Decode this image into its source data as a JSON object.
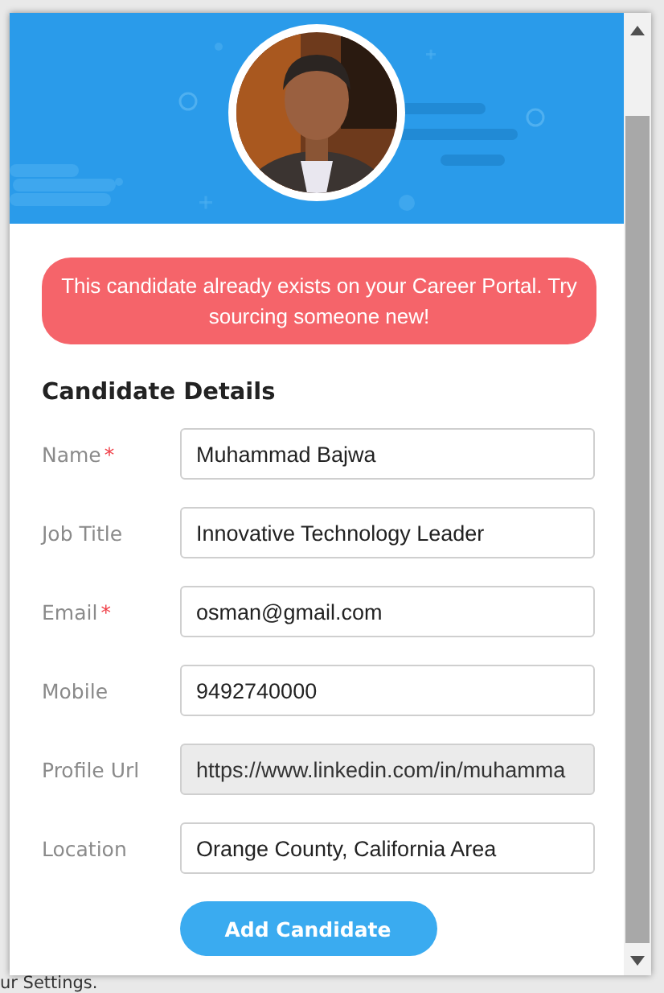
{
  "alert": {
    "text": "This candidate already exists on your Career Portal. Try sourcing someone new!"
  },
  "section_title": "Candidate Details",
  "fields": [
    {
      "label": "Name",
      "required": true,
      "value": "Muhammad Bajwa",
      "disabled": false
    },
    {
      "label": "Job Title",
      "required": false,
      "value": "Innovative Technology Leader",
      "disabled": false
    },
    {
      "label": "Email",
      "required": true,
      "value": "osman@gmail.com",
      "disabled": false
    },
    {
      "label": "Mobile",
      "required": false,
      "value": "9492740000",
      "disabled": false
    },
    {
      "label": "Profile Url",
      "required": false,
      "value": "https://www.linkedin.com/in/muhamma",
      "disabled": true
    },
    {
      "label": "Location",
      "required": false,
      "value": "Orange County, California Area",
      "disabled": false
    }
  ],
  "required_mark": "*",
  "button": "Add Candidate",
  "background_page": {
    "footer_text": "ur Settings."
  }
}
